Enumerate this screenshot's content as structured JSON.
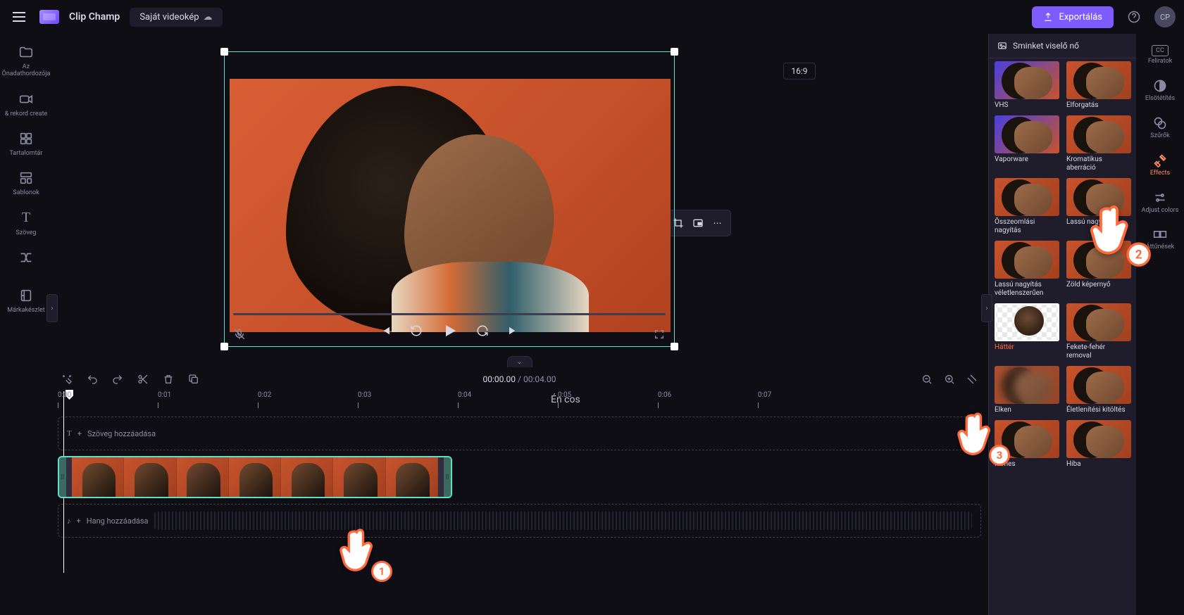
{
  "app": {
    "name": "Clip Champ",
    "project": "Saját videokép",
    "export_label": "Exportálás",
    "avatar_initials": "CP"
  },
  "left_rail": [
    {
      "icon": "folder",
      "label": "Az Önadathordozója"
    },
    {
      "icon": "camera",
      "label": "&amp; rekord create"
    },
    {
      "icon": "library",
      "label": "Tartalomtár"
    },
    {
      "icon": "templates",
      "label": "Sablonok"
    },
    {
      "icon": "text",
      "label": "Szöveg"
    },
    {
      "icon": "transition",
      "label": ""
    },
    {
      "icon": "brand",
      "label": "Márkakészlet"
    }
  ],
  "preview": {
    "aspect": "16:9",
    "floating_tools": [
      "crop",
      "pip",
      "more"
    ]
  },
  "player": {
    "current": "00:00.00",
    "separator": " / ",
    "total": "00:04.00"
  },
  "effects_panel": {
    "title": "Sminket viselő nő",
    "items": [
      {
        "name": "VHS",
        "thumb": "alt"
      },
      {
        "name": "Elforgatás",
        "thumb": "std"
      },
      {
        "name": "Vaporware",
        "thumb": "alt"
      },
      {
        "name": "Kromatikus aberráció",
        "thumb": "std"
      },
      {
        "name": "Összeomlási nagyítás",
        "thumb": "std"
      },
      {
        "name": "Lassú nagyítás",
        "thumb": "std"
      },
      {
        "name": "Lassú nagyítás véletlenszerűen",
        "thumb": "std"
      },
      {
        "name": "Zöld képernyő",
        "thumb": "std"
      },
      {
        "name": "Háttér",
        "thumb": "transparent",
        "selected": true
      },
      {
        "name": "Fekete-fehér removal",
        "thumb": "std"
      },
      {
        "name": "Elken",
        "thumb": "blurred"
      },
      {
        "name": "Életlenítési kitöltés",
        "thumb": "std"
      },
      {
        "name": "Filmes",
        "thumb": "std"
      },
      {
        "name": "Hiba",
        "thumb": "std"
      }
    ]
  },
  "prop_rail": [
    {
      "icon": "cc",
      "label": "Feliratok"
    },
    {
      "icon": "contrast",
      "label": "Elsötétítés"
    },
    {
      "icon": "filters",
      "label": "Szűrők"
    },
    {
      "icon": "effects",
      "label": "Effects",
      "active": true
    },
    {
      "icon": "adjust",
      "label": "Adjust colors"
    },
    {
      "icon": "fade",
      "label": "Áttűnések"
    }
  ],
  "timeline": {
    "ticks": [
      "0:00",
      "0:01",
      "0:02",
      "0:03",
      "0:04",
      "0:05",
      "0:06",
      "0:07"
    ],
    "watermark": "Én cos",
    "text_track": {
      "icon": "T",
      "add": "+",
      "label": "Szöveg hozzáadása"
    },
    "audio_track": {
      "icon": "♪",
      "add": "+",
      "label": "Hang hozzáadása"
    }
  },
  "hands": {
    "1": "1",
    "2": "2",
    "3": "3"
  }
}
